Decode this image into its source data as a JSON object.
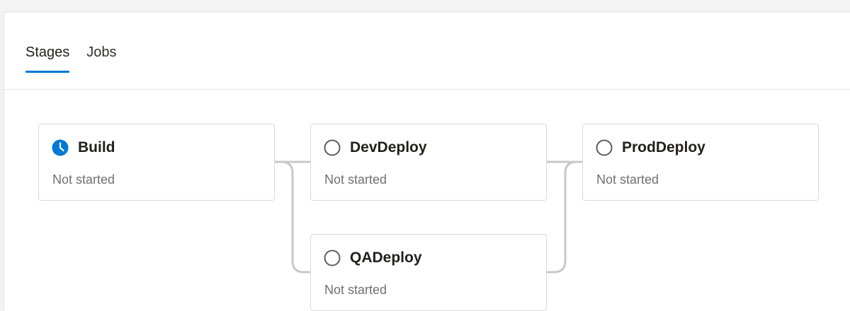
{
  "tabs": [
    {
      "label": "Stages",
      "active": true
    },
    {
      "label": "Jobs",
      "active": false
    }
  ],
  "colors": {
    "accent": "#0078d4",
    "pending_icon": "#605e5c",
    "status_text": "#707070",
    "connector": "#c8c8c8"
  },
  "stages": [
    {
      "name": "Build",
      "status": "Not started",
      "icon": "clock-icon"
    },
    {
      "name": "DevDeploy",
      "status": "Not started",
      "icon": "circle-icon"
    },
    {
      "name": "ProdDeploy",
      "status": "Not started",
      "icon": "circle-icon"
    },
    {
      "name": "QADeploy",
      "status": "Not started",
      "icon": "circle-icon"
    }
  ]
}
